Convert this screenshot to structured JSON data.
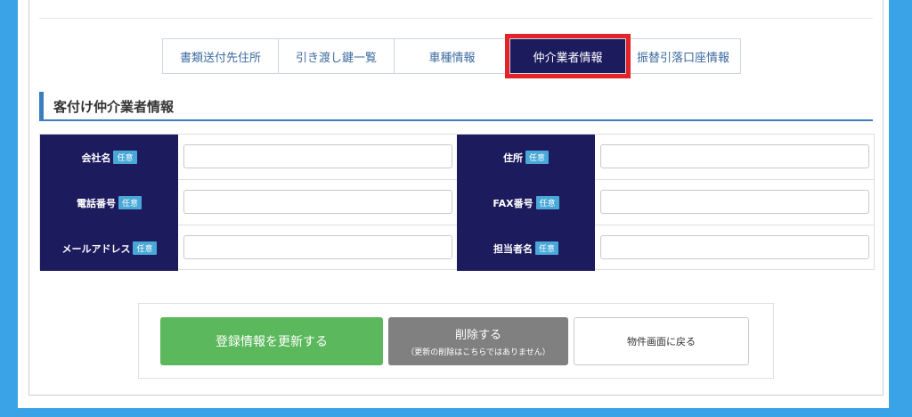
{
  "tabs": [
    {
      "label": "書類送付先住所"
    },
    {
      "label": "引き渡し鍵一覧"
    },
    {
      "label": "車種情報"
    },
    {
      "label": "仲介業者情報"
    },
    {
      "label": "振替引落口座情報"
    }
  ],
  "section": {
    "title": "客付け仲介業者情報"
  },
  "form": {
    "optional_badge": "任意",
    "fields": {
      "company_name": {
        "label": "会社名",
        "value": ""
      },
      "address": {
        "label": "住所",
        "value": ""
      },
      "phone": {
        "label": "電話番号",
        "value": ""
      },
      "fax": {
        "label": "FAX番号",
        "value": ""
      },
      "email": {
        "label": "メールアドレス",
        "value": ""
      },
      "contact_person": {
        "label": "担当者名",
        "value": ""
      }
    }
  },
  "buttons": {
    "update": "登録情報を更新する",
    "delete": "削除する",
    "delete_note": "（更新の削除はこちらではありません）",
    "back": "物件画面に戻る"
  },
  "colors": {
    "page_border": "#3aa3e8",
    "label_bg": "#1c1b5e",
    "badge_bg": "#4aa8d8",
    "active_tab_highlight": "#e3222a",
    "heading_accent": "#3d7cc0",
    "update_button": "#5cb85c",
    "delete_button": "#808080"
  }
}
